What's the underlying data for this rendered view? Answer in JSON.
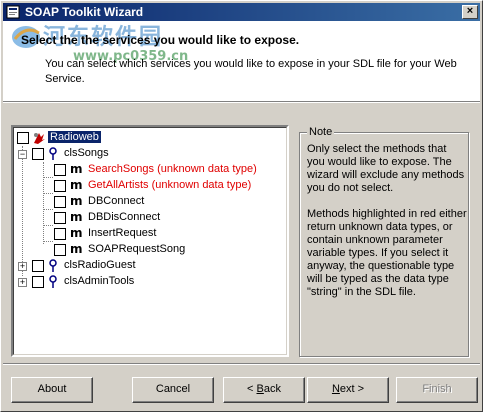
{
  "window": {
    "title": "SOAP Toolkit Wizard",
    "close_glyph": "×"
  },
  "watermark": {
    "site_name": "河东软件园",
    "url": "www.pc0359.cn"
  },
  "header": {
    "heading": "Select the the services you would like to expose.",
    "description": "You can select which services you would like to expose in your SDL file for your Web Service."
  },
  "tree": {
    "root": {
      "label": "Radioweb",
      "selected": true
    },
    "class1": {
      "label": "clsSongs",
      "expanded": true
    },
    "methods": [
      {
        "label": "SearchSongs (unknown data type)",
        "unknown": true
      },
      {
        "label": "GetAllArtists (unknown data type)",
        "unknown": true
      },
      {
        "label": "DBConnect",
        "unknown": false
      },
      {
        "label": "DBDisConnect",
        "unknown": false
      },
      {
        "label": "InsertRequest",
        "unknown": false
      },
      {
        "label": "SOAPRequestSong",
        "unknown": false
      }
    ],
    "class2": {
      "label": "clsRadioGuest",
      "expanded": false
    },
    "class3": {
      "label": "clsAdminTools",
      "expanded": false
    },
    "method_glyph": "m",
    "expand_glyph": "+",
    "collapse_glyph": "−"
  },
  "note": {
    "legend": "Note",
    "para1": "Only select the methods that you would like to expose.  The wizard will exclude any methods you do not select.",
    "para2": "Methods highlighted in red either return unknown data types, or contain unknown parameter variable types.  If you select it anyway, the questionable type will be typed as the data type \"string\" in the SDL file."
  },
  "buttons": {
    "about": "About",
    "cancel": "Cancel",
    "back_arrow": "< ",
    "back_mnemonic": "B",
    "back_rest": "ack",
    "next_mnemonic": "N",
    "next_rest": "ext >",
    "finish": "Finish"
  },
  "colors": {
    "title_start": "#0a246a",
    "title_end": "#3a6ea5",
    "unknown_method": "#e00000",
    "face": "#d4d0c8"
  }
}
